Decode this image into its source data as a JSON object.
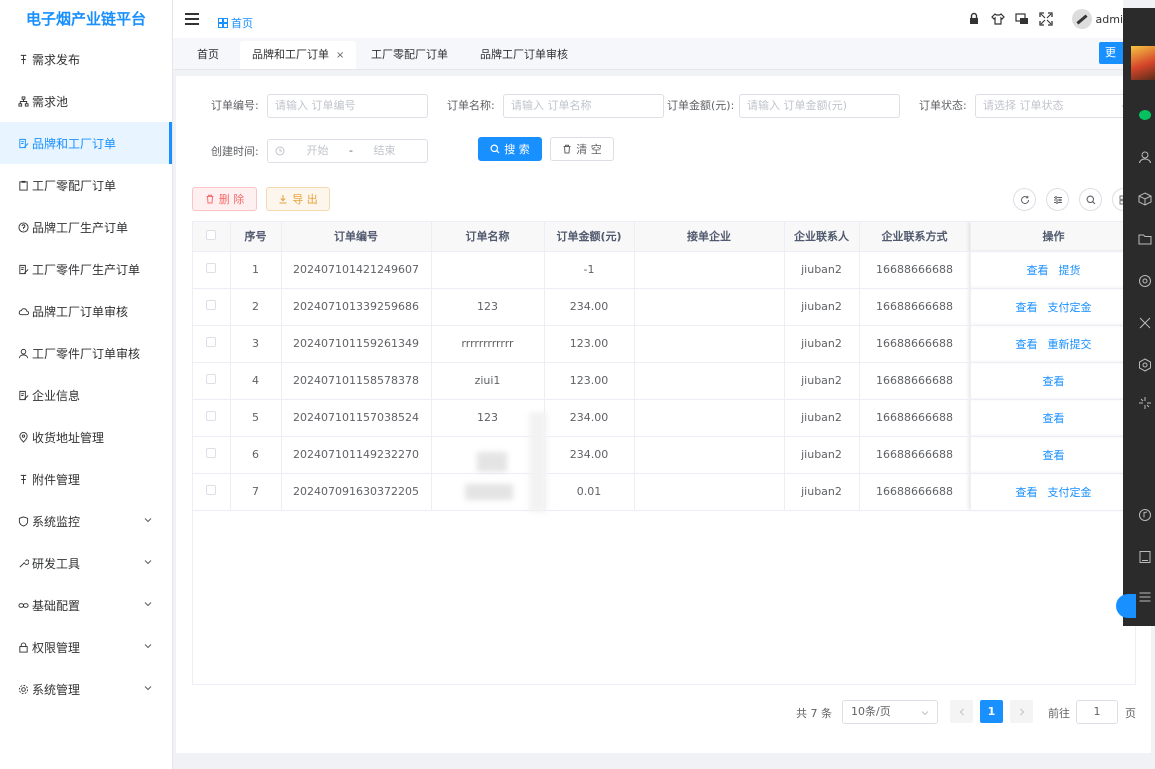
{
  "app": {
    "title": "电子烟产业链平台"
  },
  "sidebar": {
    "items": [
      {
        "label": "需求发布",
        "icon": "pin-icon",
        "has_children": false
      },
      {
        "label": "需求池",
        "icon": "tree-icon",
        "has_children": false
      },
      {
        "label": "品牌和工厂订单",
        "icon": "edit-doc-icon",
        "has_children": false,
        "active": true
      },
      {
        "label": "工厂零配厂订单",
        "icon": "clipboard-icon",
        "has_children": false
      },
      {
        "label": "品牌工厂生产订单",
        "icon": "question-icon",
        "has_children": false
      },
      {
        "label": "工厂零件厂生产订单",
        "icon": "edit-doc-icon",
        "has_children": false
      },
      {
        "label": "品牌工厂订单审核",
        "icon": "cloud-icon",
        "has_children": false
      },
      {
        "label": "工厂零件厂订单审核",
        "icon": "user-icon",
        "has_children": false
      },
      {
        "label": "企业信息",
        "icon": "edit-doc-icon",
        "has_children": false
      },
      {
        "label": "收货地址管理",
        "icon": "location-icon",
        "has_children": false
      },
      {
        "label": "附件管理",
        "icon": "pin-icon",
        "has_children": false
      },
      {
        "label": "系统监控",
        "icon": "shield-icon",
        "has_children": true
      },
      {
        "label": "研发工具",
        "icon": "tool-icon",
        "has_children": true
      },
      {
        "label": "基础配置",
        "icon": "link-icon",
        "has_children": true
      },
      {
        "label": "权限管理",
        "icon": "lock-icon",
        "has_children": true
      },
      {
        "label": "系统管理",
        "icon": "gear-icon",
        "has_children": true
      }
    ]
  },
  "header": {
    "breadcrumb": "首页",
    "user": "admi",
    "icons": [
      "lock-icon",
      "shirt-icon",
      "screen-icon",
      "fullscreen-icon"
    ]
  },
  "tags": {
    "items": [
      {
        "label": "首页",
        "active": false,
        "closable": false
      },
      {
        "label": "品牌和工厂订单",
        "active": true,
        "closable": true
      },
      {
        "label": "工厂零配厂订单",
        "active": false,
        "closable": false
      },
      {
        "label": "品牌工厂订单审核",
        "active": false,
        "closable": false
      }
    ],
    "close_glyph": "×",
    "more_label": "更"
  },
  "search": {
    "order_no_label": "订单编号:",
    "order_no_placeholder": "请输入 订单编号",
    "order_name_label": "订单名称:",
    "order_name_placeholder": "请输入 订单名称",
    "amount_label": "订单金额(元):",
    "amount_placeholder": "请输入 订单金额(元)",
    "status_label": "订单状态:",
    "status_placeholder": "请选择 订单状态",
    "created_label": "创建时间:",
    "start_placeholder": "开始",
    "range_sep": "-",
    "end_placeholder": "结束",
    "search_button": "搜 索",
    "clear_button": "清 空"
  },
  "toolbar": {
    "delete_button": "删 除",
    "export_button": "导 出",
    "right_icons": [
      "refresh-icon",
      "filter-icon",
      "search-icon",
      "grid-icon"
    ]
  },
  "table": {
    "columns": [
      "序号",
      "订单编号",
      "订单名称",
      "订单金额(元)",
      "接单企业",
      "企业联系人",
      "企业联系方式",
      "操作"
    ],
    "rows": [
      {
        "index": "1",
        "order_no": "202407101421249607",
        "name": "",
        "amount": "-1",
        "company": "",
        "contact": "jiuban2",
        "phone": "16688666688",
        "actions": [
          "查看",
          "提货"
        ]
      },
      {
        "index": "2",
        "order_no": "202407101339259686",
        "name": "123",
        "amount": "234.00",
        "company": "",
        "contact": "jiuban2",
        "phone": "16688666688",
        "actions": [
          "查看",
          "支付定金"
        ]
      },
      {
        "index": "3",
        "order_no": "202407101159261349",
        "name": "rrrrrrrrrrrr",
        "amount": "123.00",
        "company": "",
        "contact": "jiuban2",
        "phone": "16688666688",
        "actions": [
          "查看",
          "重新提交"
        ]
      },
      {
        "index": "4",
        "order_no": "202407101158578378",
        "name": "ziui1",
        "amount": "123.00",
        "company": "",
        "contact": "jiuban2",
        "phone": "16688666688",
        "actions": [
          "查看"
        ]
      },
      {
        "index": "5",
        "order_no": "202407101157038524",
        "name": "123",
        "amount": "234.00",
        "company": "",
        "contact": "jiuban2",
        "phone": "16688666688",
        "actions": [
          "查看"
        ]
      },
      {
        "index": "6",
        "order_no": "202407101149232270",
        "name": "",
        "amount": "234.00",
        "company": "",
        "contact": "jiuban2",
        "phone": "16688666688",
        "actions": [
          "查看"
        ]
      },
      {
        "index": "7",
        "order_no": "202407091630372205",
        "name": "",
        "amount": "0.01",
        "company": "",
        "contact": "jiuban2",
        "phone": "16688666688",
        "actions": [
          "查看",
          "支付定金"
        ]
      }
    ]
  },
  "pagination": {
    "total_text": "共 7 条",
    "page_size": "10条/页",
    "current_page": "1",
    "goto_label": "前往",
    "goto_value": "1",
    "page_suffix": "页"
  },
  "colors": {
    "primary": "#1890ff",
    "danger": "#f56c6c",
    "warning": "#e6a23c"
  }
}
